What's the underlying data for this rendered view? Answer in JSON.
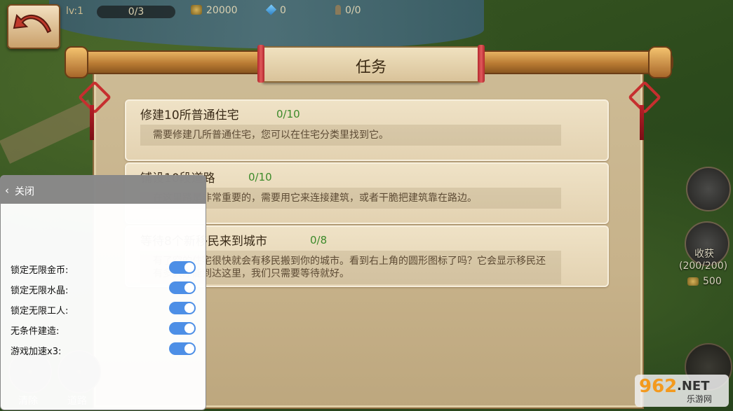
{
  "hud": {
    "level": "lv:1",
    "population": "0/3",
    "gold": "20000",
    "crystal": "0",
    "workers": "0/0"
  },
  "quest_panel": {
    "title": "任务",
    "tasks": [
      {
        "name": "修建10所普通住宅",
        "progress": "0/10",
        "desc": "需要修建几所普通住宅，您可以在住宅分类里找到它。"
      },
      {
        "name": "铺设10段道路",
        "progress": "0/10",
        "desc": "在这里路是非常重要的，需要用它来连接建筑，或者干脆把建筑靠在路边。"
      },
      {
        "name": "等待8个新移民来到城市",
        "progress": "0/8",
        "desc": "有了空的住宅很快就会有移民搬到你的城市。看到右上角的圆形图标了吗？它会显示移民还有多久才能到达这里，我们只需要等待就好。"
      }
    ]
  },
  "side": {
    "harvest_label": "收获",
    "harvest_count": "(200/200)",
    "harvest_coins": "500"
  },
  "bottom": {
    "clear_label": "清除",
    "road_label": "道路"
  },
  "cheat_menu": {
    "close_label": "关闭",
    "options": [
      {
        "label": "锁定无限金币:",
        "on": true
      },
      {
        "label": "锁定无限水晶:",
        "on": true
      },
      {
        "label": "锁定无限工人:",
        "on": true
      },
      {
        "label": "无条件建造:",
        "on": true
      },
      {
        "label": "游戏加速x3:",
        "on": true
      }
    ]
  },
  "watermark": {
    "num": "962",
    "net": ".NET",
    "site": "乐游网"
  },
  "colors": {
    "progress": "#3c8a2a",
    "toggle": "#4d8fe6",
    "accent_red": "#c62f2f"
  }
}
